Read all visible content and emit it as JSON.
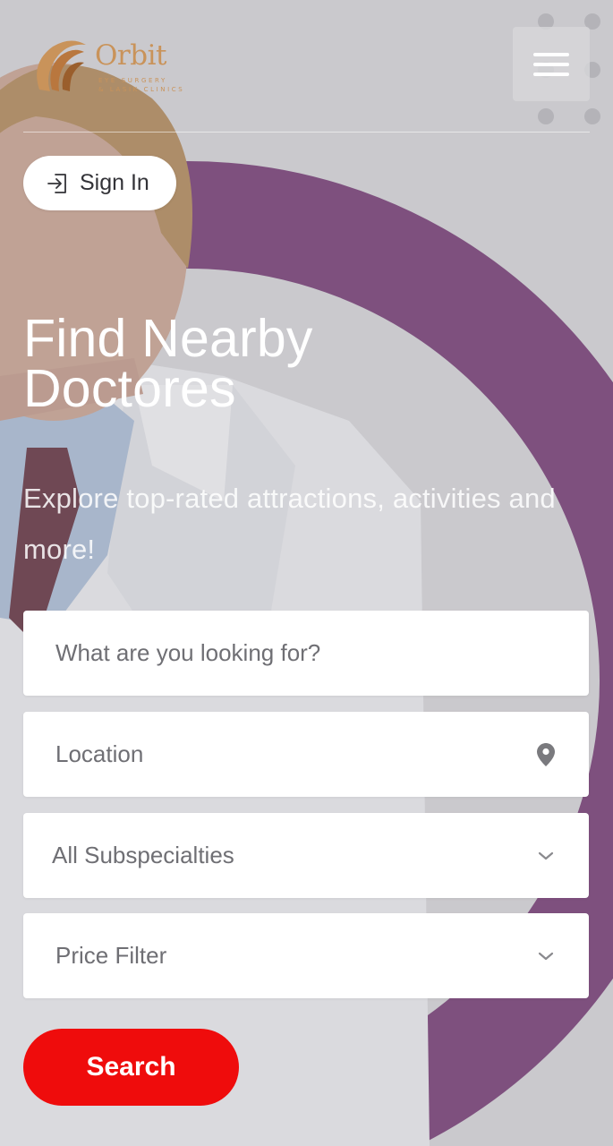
{
  "header": {
    "logo_name": "Orbit",
    "logo_sub_line1": "EYE SURGERY",
    "logo_sub_line2": "& LASIK CLINICS",
    "menu_icon": "hamburger-icon"
  },
  "signin": {
    "label": "Sign In",
    "icon": "sign-in-icon"
  },
  "hero": {
    "title": "Find Nearby Doctores",
    "subtitle": "Explore top-rated attractions, activities and more!"
  },
  "form": {
    "search_placeholder": "What are you looking for?",
    "location_placeholder": "Location",
    "location_icon": "map-pin-icon",
    "subspecialty_selected": "All Subspecialties",
    "price_selected": "Price Filter",
    "dropdown_icon": "chevron-down-icon",
    "search_button": "Search"
  },
  "colors": {
    "accent_purple": "#6b2e6b",
    "brand_gold": "#c9935a",
    "search_red": "#ef0c0c"
  }
}
